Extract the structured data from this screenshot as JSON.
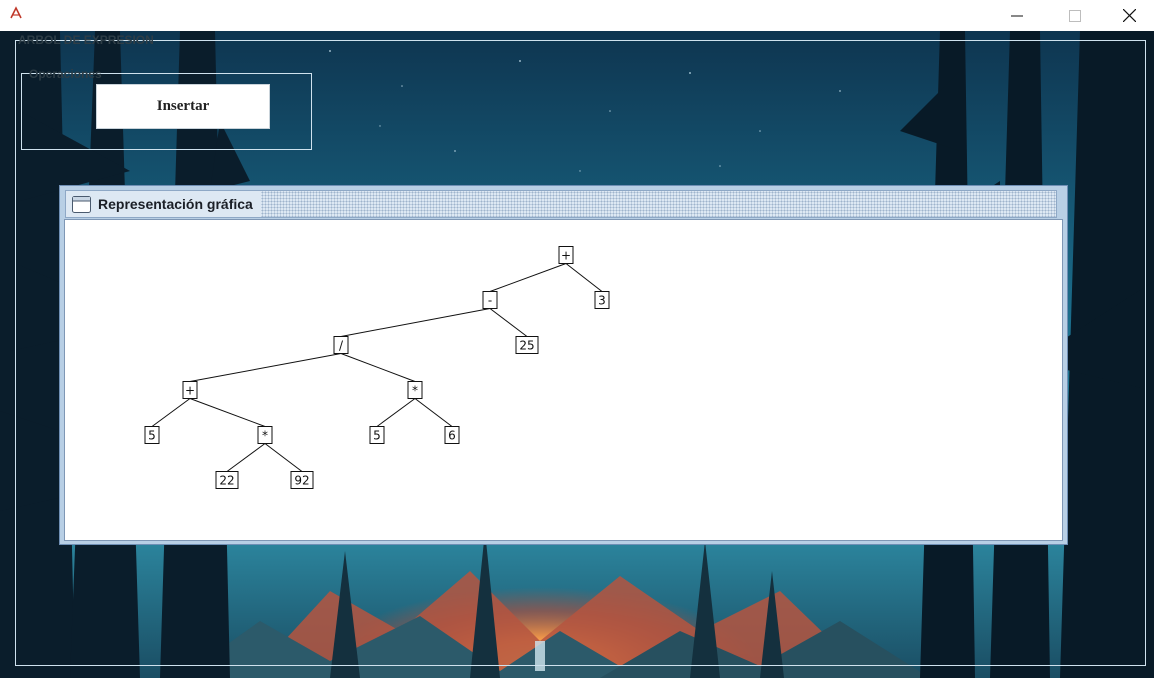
{
  "window": {
    "minimize_icon": "minimize-icon",
    "maximize_icon": "maximize-icon",
    "close_icon": "close-icon",
    "app_icon": "java-app-icon"
  },
  "main": {
    "outer_border_title": "ARBOL DE EXPRESION",
    "operations": {
      "title": "Operaciones",
      "insert_button": "Insertar"
    }
  },
  "graph_frame": {
    "title": "Representación gráfica",
    "icon": "frame-icon",
    "tree": {
      "nodes": [
        {
          "id": "n_plus_root",
          "label": "+"
        },
        {
          "id": "n_minus",
          "label": "-"
        },
        {
          "id": "n_3",
          "label": "3"
        },
        {
          "id": "n_div",
          "label": "/"
        },
        {
          "id": "n_25",
          "label": "25"
        },
        {
          "id": "n_plus_2",
          "label": "+"
        },
        {
          "id": "n_mul_right",
          "label": "*"
        },
        {
          "id": "n_5a",
          "label": "5"
        },
        {
          "id": "n_mul_left",
          "label": "*"
        },
        {
          "id": "n_5b",
          "label": "5"
        },
        {
          "id": "n_6",
          "label": "6"
        },
        {
          "id": "n_22",
          "label": "22"
        },
        {
          "id": "n_92",
          "label": "92"
        }
      ],
      "edges": [
        [
          "n_plus_root",
          "n_minus"
        ],
        [
          "n_plus_root",
          "n_3"
        ],
        [
          "n_minus",
          "n_div"
        ],
        [
          "n_minus",
          "n_25"
        ],
        [
          "n_div",
          "n_plus_2"
        ],
        [
          "n_div",
          "n_mul_right"
        ],
        [
          "n_plus_2",
          "n_5a"
        ],
        [
          "n_plus_2",
          "n_mul_left"
        ],
        [
          "n_mul_right",
          "n_5b"
        ],
        [
          "n_mul_right",
          "n_6"
        ],
        [
          "n_mul_left",
          "n_22"
        ],
        [
          "n_mul_left",
          "n_92"
        ]
      ]
    }
  }
}
